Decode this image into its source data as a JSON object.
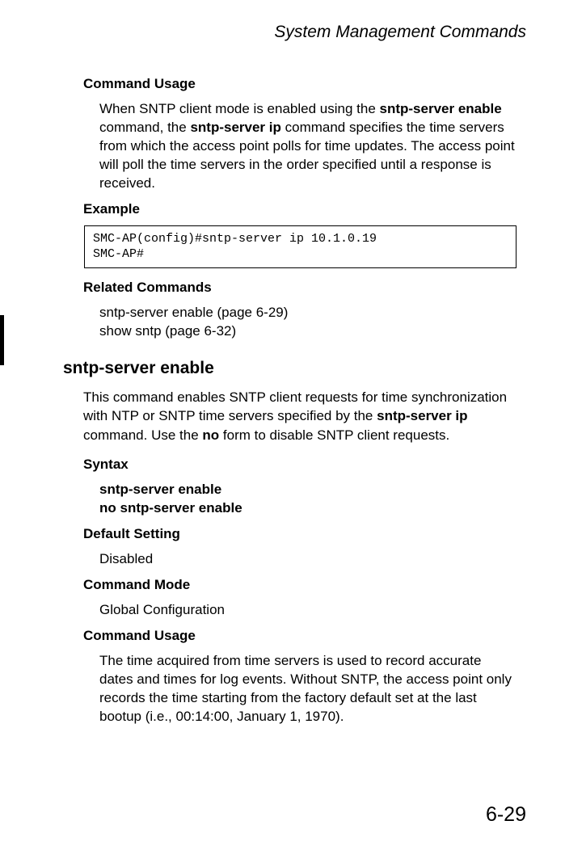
{
  "header": {
    "title": "System Management Commands"
  },
  "sections": {
    "commandUsage1": {
      "label": "Command Usage",
      "pre": "When SNTP client mode is enabled using the ",
      "bold1": "sntp-server enable",
      "mid1": " command, the ",
      "bold2": "sntp-server ip",
      "post": " command specifies the time servers from which the access point polls for time updates. The access point will poll the time servers in the order specified until a response is received."
    },
    "example": {
      "label": "Example",
      "code": "SMC-AP(config)#sntp-server ip 10.1.0.19\nSMC-AP#"
    },
    "related": {
      "label": "Related Commands",
      "line1": "sntp-server enable (page 6-29)",
      "line2": "show sntp (page 6-32)"
    },
    "cmdTitle": "sntp-server enable",
    "cmdDesc": {
      "pre": "This command enables SNTP client requests for time synchronization with NTP or SNTP time servers specified by the ",
      "bold1": "sntp-server ip",
      "mid1": " command. Use the ",
      "bold2": "no",
      "post": " form to disable SNTP client requests."
    },
    "syntax": {
      "label": "Syntax",
      "line1": "sntp-server enable",
      "line2": "no sntp-server enable"
    },
    "defaultSetting": {
      "label": "Default Setting",
      "value": "Disabled"
    },
    "commandMode": {
      "label": "Command Mode",
      "value": "Global Configuration"
    },
    "commandUsage2": {
      "label": "Command Usage",
      "text": "The time acquired from time servers is used to record accurate dates and times for log events. Without SNTP, the access point only records the time starting from the factory default set at the last bootup (i.e., 00:14:00, January 1, 1970)."
    }
  },
  "pageNumber": "6-29"
}
